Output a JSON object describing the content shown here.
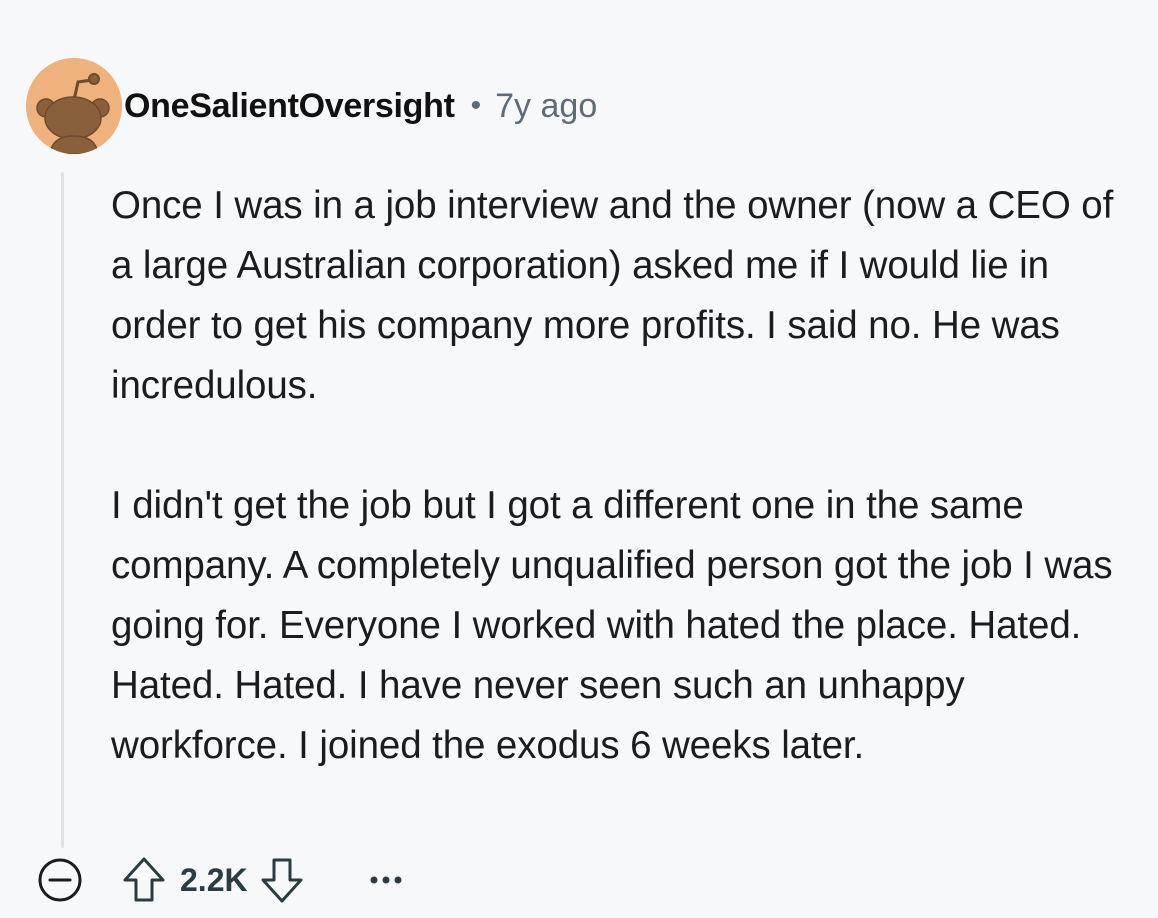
{
  "comment": {
    "author": "OneSalientOversight",
    "separator": "•",
    "time": "7y ago",
    "paragraphs": [
      "Once I was in a job interview and the owner (now a CEO of a large Australian corporation) asked me if I would lie in order to get his company more profits. I said no. He was incredulous.",
      "I didn't get the job but I got a different one in the same company. A completely unqualified person got the job I was going for. Everyone I worked with hated the place. Hated. Hated. Hated. I have never seen such an unhappy workforce. I joined the exodus 6 weeks later."
    ]
  },
  "actions": {
    "score": "2.2K"
  },
  "icons": {
    "collapse": "minus-circle-icon",
    "upvote": "arrow-up-outline-icon",
    "downvote": "arrow-down-outline-icon",
    "more": "overflow-dots-icon",
    "avatar": "snoo-avatar-icon"
  },
  "colors": {
    "background": "#f7f8fa",
    "avatar_bg": "#efb27d",
    "avatar_figure": "#8a5f3c",
    "meta_text": "#5f6b76",
    "thread_line": "#dfe3e8"
  }
}
